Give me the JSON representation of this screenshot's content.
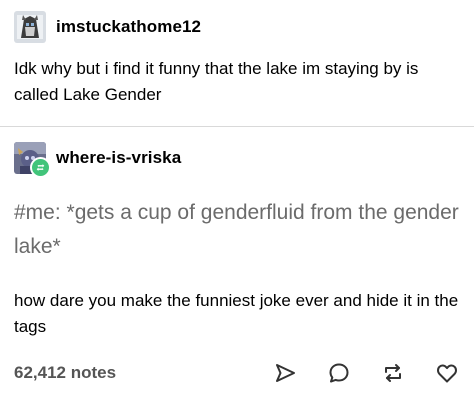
{
  "post": {
    "original": {
      "username": "imstuckathome12",
      "body": "Idk why but i find it funny that the lake im staying by is called Lake Gender"
    },
    "reblog": {
      "username": "where-is-vriska",
      "tags_text": "#me: *gets a cup of genderfluid from the gender lake*",
      "body": "how dare you make the funniest joke ever and hide it in the tags"
    },
    "footer": {
      "notes": "62,412 notes"
    }
  },
  "icons": {
    "share": "share-icon",
    "reply": "reply-icon",
    "reblog": "reblog-icon",
    "like": "heart-icon",
    "reblog_badge": "reblog-badge-icon"
  },
  "colors": {
    "text": "#000000",
    "tags": "#6b6b6b",
    "notes": "#555555",
    "divider": "#d9d9d9",
    "reblog_badge": "#41c47a"
  }
}
